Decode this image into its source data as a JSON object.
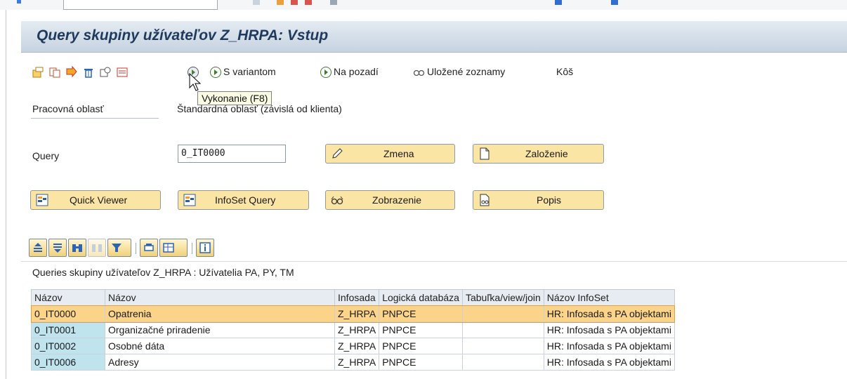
{
  "window": {
    "title": "Query skupiny užívateľov Z_HRPA: Vstup"
  },
  "toolbar": {
    "s_variantom": "S variantom",
    "na_pozadi": "Na pozadí",
    "ulozene_zoznamy": "Uložené zoznamy",
    "kos": "Kôš",
    "tooltip": "Vykonanie  (F8)"
  },
  "form": {
    "work_area_label": "Pracovná oblasť",
    "work_area_value": "Štandardná oblasť (závislá od klienta)",
    "query_label": "Query",
    "query_value": "0_IT0000"
  },
  "buttons": {
    "zmena": "Zmena",
    "zalozenie": "Založenie",
    "quick_viewer": "Quick Viewer",
    "infoset_query": "InfoSet Query",
    "zobrazenie": "Zobrazenie",
    "popis": "Popis"
  },
  "grid": {
    "title": "Queries skupiny užívateľov Z_HRPA : Užívatelia PA, PY, TM",
    "columns": [
      "Názov",
      "Názov",
      "Infosada",
      "Logická databáza",
      "Tabuľka/view/join",
      "Názov InfoSet"
    ],
    "rows": [
      [
        "0_IT0000",
        "Opatrenia",
        "Z_HRPA",
        "PNPCE",
        "",
        "HR: Infosada s PA objektami"
      ],
      [
        "0_IT0001",
        "Organizačné priradenie",
        "Z_HRPA",
        "PNPCE",
        "",
        "HR: Infosada s PA objektami"
      ],
      [
        "0_IT0002",
        "Osobné dáta",
        "Z_HRPA",
        "PNPCE",
        "",
        "HR: Infosada s PA objektami"
      ],
      [
        "0_IT0006",
        "Adresy",
        "Z_HRPA",
        "PNPCE",
        "",
        "HR: Infosada s PA objektami"
      ]
    ],
    "selected_row": 0
  },
  "colors": {
    "button_bg": "#fbe5a4",
    "selected_row": "#fbd48a",
    "key_cell": "#bfe4ee",
    "title_text": "#1f3a5c"
  }
}
